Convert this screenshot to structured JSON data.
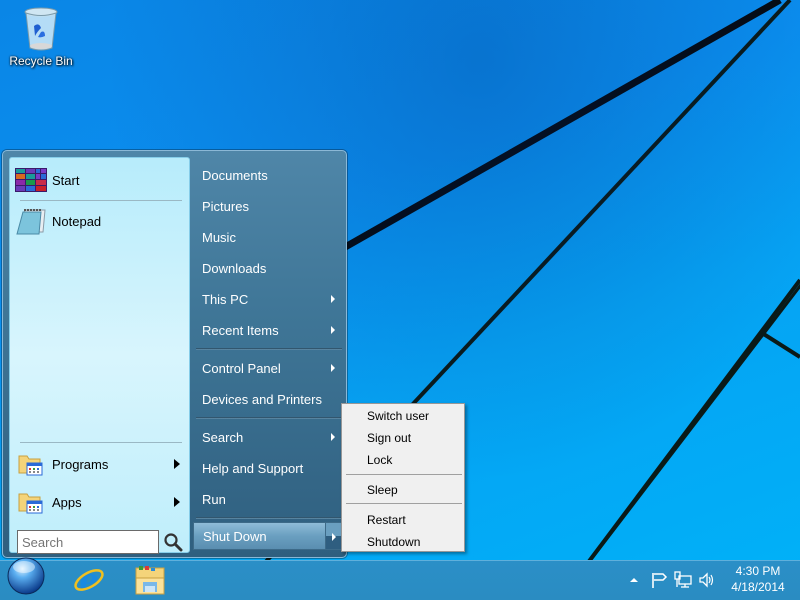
{
  "desktop": {
    "icons": [
      {
        "label": "Recycle Bin",
        "icon": "recycle-bin-icon"
      }
    ]
  },
  "start_menu": {
    "left_pane": {
      "pinned": [
        {
          "label": "Start",
          "icon": "windows-start-tiles-icon"
        },
        {
          "label": "Notepad",
          "icon": "notepad-icon"
        }
      ],
      "bottom": [
        {
          "label": "Programs",
          "icon": "programs-folder-icon",
          "has_submenu": true
        },
        {
          "label": "Apps",
          "icon": "apps-folder-icon",
          "has_submenu": true
        }
      ],
      "search": {
        "placeholder": "Search",
        "value": ""
      }
    },
    "right_pane": {
      "items": [
        {
          "label": "Documents",
          "has_submenu": false
        },
        {
          "label": "Pictures",
          "has_submenu": false
        },
        {
          "label": "Music",
          "has_submenu": false
        },
        {
          "label": "Downloads",
          "has_submenu": false
        },
        {
          "label": "This PC",
          "has_submenu": true
        },
        {
          "label": "Recent Items",
          "has_submenu": true
        },
        {
          "label": "Control Panel",
          "has_submenu": true
        },
        {
          "label": "Devices and Printers",
          "has_submenu": false
        },
        {
          "label": "Search",
          "has_submenu": true
        },
        {
          "label": "Help and Support",
          "has_submenu": false
        },
        {
          "label": "Run",
          "has_submenu": false
        }
      ],
      "shutdown_label": "Shut Down"
    }
  },
  "power_menu": {
    "items": [
      {
        "label": "Switch user"
      },
      {
        "label": "Sign out"
      },
      {
        "label": "Lock"
      },
      {
        "label": "Sleep"
      },
      {
        "label": "Restart"
      },
      {
        "label": "Shutdown"
      }
    ]
  },
  "taskbar": {
    "pinned": [
      {
        "name": "internet-explorer",
        "icon": "internet-explorer-icon"
      },
      {
        "name": "file-explorer",
        "icon": "file-explorer-icon"
      }
    ],
    "tray_icons": [
      "show-hidden-icons-icon",
      "action-center-flag-icon",
      "network-icon",
      "volume-icon"
    ],
    "clock": {
      "time": "4:30 PM",
      "date": "4/18/2014"
    }
  },
  "colors": {
    "desktop_blue": "#0b8ff0",
    "taskbar": "#2a8cc2",
    "start_menu_left": "#c8f0fc",
    "start_menu_right": "#3f7697",
    "power_menu_bg": "#f0f0f0"
  }
}
